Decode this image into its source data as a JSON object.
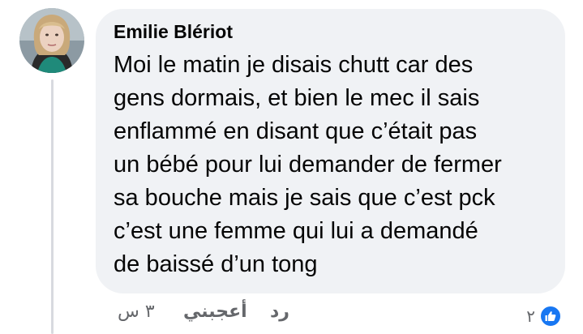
{
  "comment": {
    "author": "Emilie Blériot",
    "text_lines": [
      "Moi le matin je disais chutt car des",
      "gens dormais, et bien le mec il sais",
      "enflammé en disant que c’était pas",
      "un bébé pour lui demander de fermer",
      "sa bouche mais je sais que c’est pck",
      "c’est une femme qui lui a demandé",
      "de baissé d’un tong"
    ]
  },
  "actions": {
    "time": "٣ س",
    "like_label": "أعجبني",
    "reply_label": "رد"
  },
  "reactions": {
    "count": "٢",
    "icon": "thumbs-up-icon",
    "color": "#1877f2"
  },
  "colors": {
    "bubble": "#f0f2f5",
    "text": "#050505",
    "meta": "#65676b"
  }
}
